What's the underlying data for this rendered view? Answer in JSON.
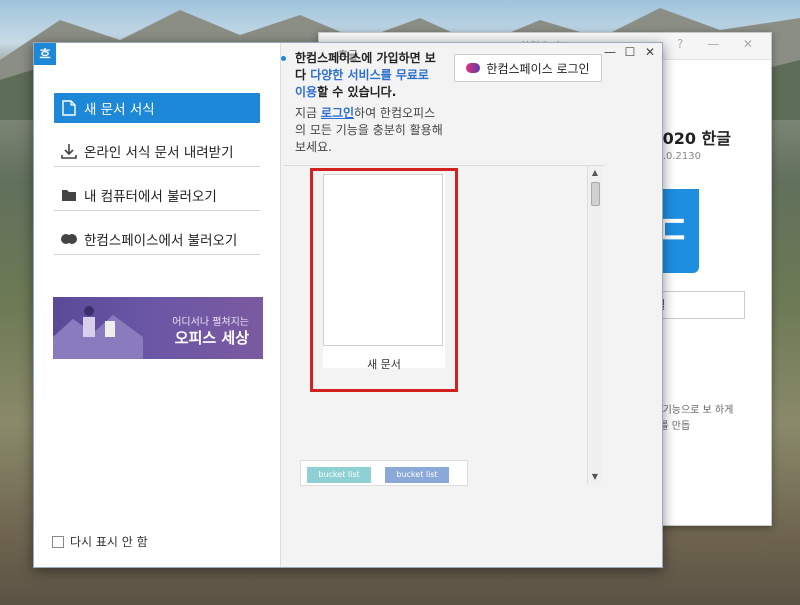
{
  "background_window": {
    "title": "한컴오피스",
    "controls": "? — ✕",
    "product": "2020 한글",
    "version": ".0.2130",
    "logo_glyph": "ㄷ",
    "button_label": "텔",
    "description": "편집 기능으로 보 하게 문서를 만듭"
  },
  "dialog": {
    "app_badge": "흐",
    "title": "흔글",
    "controls": {
      "minimize": "—",
      "maximize": "☐",
      "close": "✕"
    },
    "menu": [
      {
        "label": "새 문서 서식",
        "icon": "document-icon",
        "active": true
      },
      {
        "label": "온라인 서식 문서 내려받기",
        "icon": "download-icon",
        "active": false
      },
      {
        "label": "내 컴퓨터에서 불러오기",
        "icon": "folder-icon",
        "active": false
      },
      {
        "label": "한컴스페이스에서 불러오기",
        "icon": "cloud-icon",
        "active": false
      }
    ],
    "banner": {
      "line1": "어디서나 펼쳐지는",
      "line2": "오피스 세상"
    },
    "dont_show_again": "다시 표시 안 함",
    "notice": {
      "head_part1": "한컴스페이스에 가입하면 보다 ",
      "head_highlight": "다양한 서비스를 무료로 이용",
      "head_part2": "할 수 있습니다.",
      "sub_part1": "지금 ",
      "sub_link": "로그인",
      "sub_part2": "하여 한컴오피스의 모든 기능을 충분히 활용해 보세요."
    },
    "login_button": "한컴스페이스 로그인",
    "new_document_label": "새 문서",
    "thumbs": [
      "bucket list",
      "bucket list"
    ]
  },
  "colors": {
    "accent": "#1e88d8",
    "highlight_box": "#d32020",
    "link": "#2b6fd0"
  }
}
